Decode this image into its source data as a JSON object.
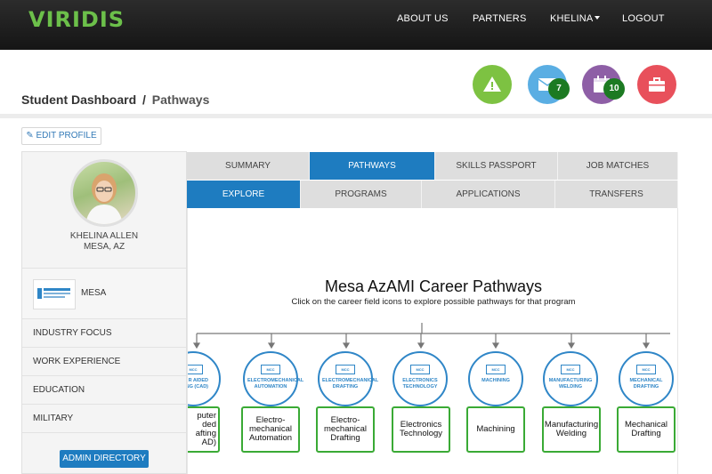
{
  "brand": {
    "logo_text": "VIRIDIS",
    "accent_color": "#6cc04a"
  },
  "nav": {
    "about": "ABOUT US",
    "partners": "PARTNERS",
    "user": "KHELINA",
    "logout": "LOGOUT"
  },
  "header": {
    "title": "Student Dashboard",
    "separator": "/",
    "subtitle": "Pathways"
  },
  "quick_actions": [
    {
      "icon": "warning-icon",
      "color": "#7dc242"
    },
    {
      "icon": "mail-icon",
      "color": "#5aaee3",
      "badge": "7"
    },
    {
      "icon": "calendar-icon",
      "color": "#8e5fa6",
      "badge": "10"
    },
    {
      "icon": "briefcase-icon",
      "color": "#e8505b"
    }
  ],
  "profile": {
    "edit_label": "EDIT PROFILE",
    "name": "KHELINA ALLEN",
    "location": "MESA, AZ",
    "school_name": "MESA",
    "school_logo_text": "MESA COMMUNITY COLLEGE"
  },
  "side_menu": [
    "INDUSTRY FOCUS",
    "WORK EXPERIENCE",
    "EDUCATION",
    "MILITARY"
  ],
  "admin_button": "ADMIN DIRECTORY",
  "tabs": [
    "SUMMARY",
    "PATHWAYS",
    "SKILLS PASSPORT",
    "JOB MATCHES"
  ],
  "active_tab": "PATHWAYS",
  "subtabs": [
    "EXPLORE",
    "PROGRAMS",
    "APPLICATIONS",
    "TRANSFERS"
  ],
  "active_subtab": "EXPLORE",
  "career": {
    "title": "Mesa AzAMI Career Pathways",
    "subtitle": "Click on the career field icons to explore possible pathways for that program",
    "fields": [
      {
        "circle": "COMPUTER AIDED DRAFTING (CAD)",
        "circle_visible": "R AIDED\nING (CAD)",
        "box": "Computer Aided Drafting (CAD)",
        "box_visible": "puter\nded\nafting\nAD)"
      },
      {
        "circle": "ELECTROMECHANICAL AUTOMATION",
        "box": "Electro-\nmechanical\nAutomation"
      },
      {
        "circle": "ELECTROMECHANICAL DRAFTING",
        "box": "Electro-\nmechanical\nDrafting"
      },
      {
        "circle": "ELECTRONICS TECHNOLOGY",
        "box": "Electronics\nTechnology"
      },
      {
        "circle": "MACHINING",
        "box": "Machining"
      },
      {
        "circle": "MANUFACTURING WELDING",
        "box": "Manufacturing\nWelding"
      },
      {
        "circle": "MECHANICAL DRAFTING",
        "box": "Mechanical\nDrafting"
      }
    ]
  }
}
